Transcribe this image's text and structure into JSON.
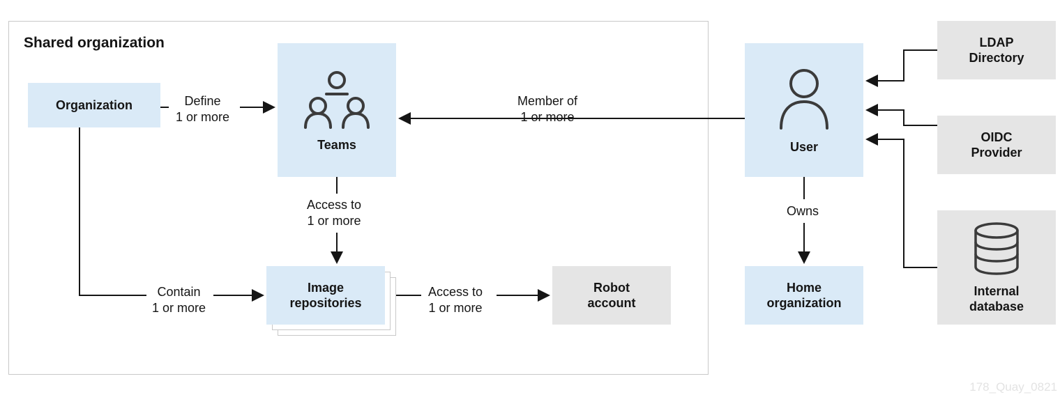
{
  "title": "Shared organization",
  "nodes": {
    "organization": {
      "label": "Organization"
    },
    "teams": {
      "label": "Teams"
    },
    "image_repos": {
      "line1": "Image",
      "line2": "repositories"
    },
    "robot_account": {
      "line1": "Robot",
      "line2": "account"
    },
    "user": {
      "label": "User"
    },
    "home_org": {
      "line1": "Home",
      "line2": "organization"
    },
    "ldap": {
      "line1": "LDAP",
      "line2": "Directory"
    },
    "oidc": {
      "line1": "OIDC",
      "line2": "Provider"
    },
    "internal_db": {
      "line1": "Internal",
      "line2": "database"
    }
  },
  "edges": {
    "define": {
      "line1": "Define",
      "line2": "1 or more"
    },
    "member_of": {
      "line1": "Member of",
      "line2": "1 or more"
    },
    "access_to_teams": {
      "line1": "Access to",
      "line2": "1 or more"
    },
    "contain": {
      "line1": "Contain",
      "line2": "1 or more"
    },
    "access_to_repos": {
      "line1": "Access to",
      "line2": "1 or more"
    },
    "owns": {
      "line1": "Owns"
    }
  },
  "watermark": "178_Quay_0821"
}
